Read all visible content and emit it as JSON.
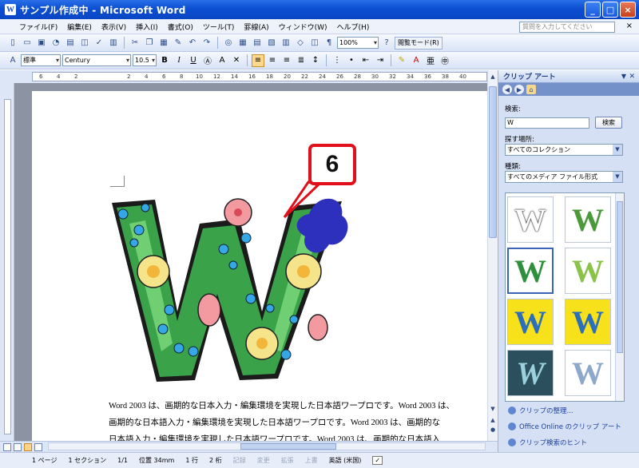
{
  "window": {
    "title": "サンプル作成中 - Microsoft Word",
    "app_icon": "W"
  },
  "window_buttons": {
    "minimize": "_",
    "maximize": "□",
    "close": "×"
  },
  "menu": [
    "ファイル(F)",
    "編集(E)",
    "表示(V)",
    "挿入(I)",
    "書式(O)",
    "ツール(T)",
    "罫線(A)",
    "ウィンドウ(W)",
    "ヘルプ(H)"
  ],
  "help_box": {
    "placeholder": "質問を入力してください",
    "close": "×"
  },
  "toolbar_standard": {
    "zoom": "100%",
    "reading_mode": "閲覧モード(R)"
  },
  "toolbar_format": {
    "style": "標準",
    "font": "Century",
    "size": "10.5",
    "bold": "B",
    "italic": "I",
    "underline": "U"
  },
  "ruler_ticks": [
    "6",
    "4",
    "2",
    "2",
    "4",
    "6",
    "8",
    "10",
    "12",
    "14",
    "16",
    "18",
    "20",
    "22",
    "24",
    "26",
    "28",
    "30",
    "32",
    "34",
    "36",
    "38",
    "40"
  ],
  "document": {
    "callout_number": "6",
    "body_lines": [
      "Word 2003 は、画期的な日本入力・編集環境を実現した日本語ワープロです。Word 2003 は、",
      "画期的な日本語入力・編集環境を実現した日本語ワープロです。Word 2003 は、画期的な",
      "日本語入力・編集環境を実現した日本語ワープロです。Word 2003 は、画期的な日本語入"
    ]
  },
  "task_pane": {
    "title": "クリップ アート",
    "search_label": "検索:",
    "search_value": "W",
    "search_button": "検索",
    "location_label": "探す場所:",
    "location_value": "すべてのコレクション",
    "type_label": "種類:",
    "type_value": "すべてのメディア ファイル形式",
    "links": [
      "クリップの整理...",
      "Office Online のクリップ アート",
      "クリップ検索のヒント"
    ]
  },
  "statusbar": {
    "page": "1 ページ",
    "section": "1 セクション",
    "pages": "1/1",
    "position": "位置 34mm",
    "line": "1 行",
    "column": "2 桁",
    "rec": "記録",
    "trk": "変更",
    "ext": "拡張",
    "ovr": "上書",
    "language": "英語 (米国)"
  },
  "colors": {
    "title_bar": "#0b4fd1",
    "callout_border": "#e0101a",
    "leaf_green": "#3aa34a",
    "task_pane_bg": "#d6e0f5"
  },
  "icons": [
    "word-app-icon",
    "new-icon",
    "open-icon",
    "save-icon",
    "print-icon",
    "spelling-icon",
    "cut-icon",
    "copy-icon",
    "paste-icon",
    "undo-icon",
    "redo-icon",
    "table-icon",
    "drawing-icon",
    "help-icon",
    "bullets-icon",
    "numbering-icon",
    "highlight-icon",
    "font-color-icon"
  ]
}
